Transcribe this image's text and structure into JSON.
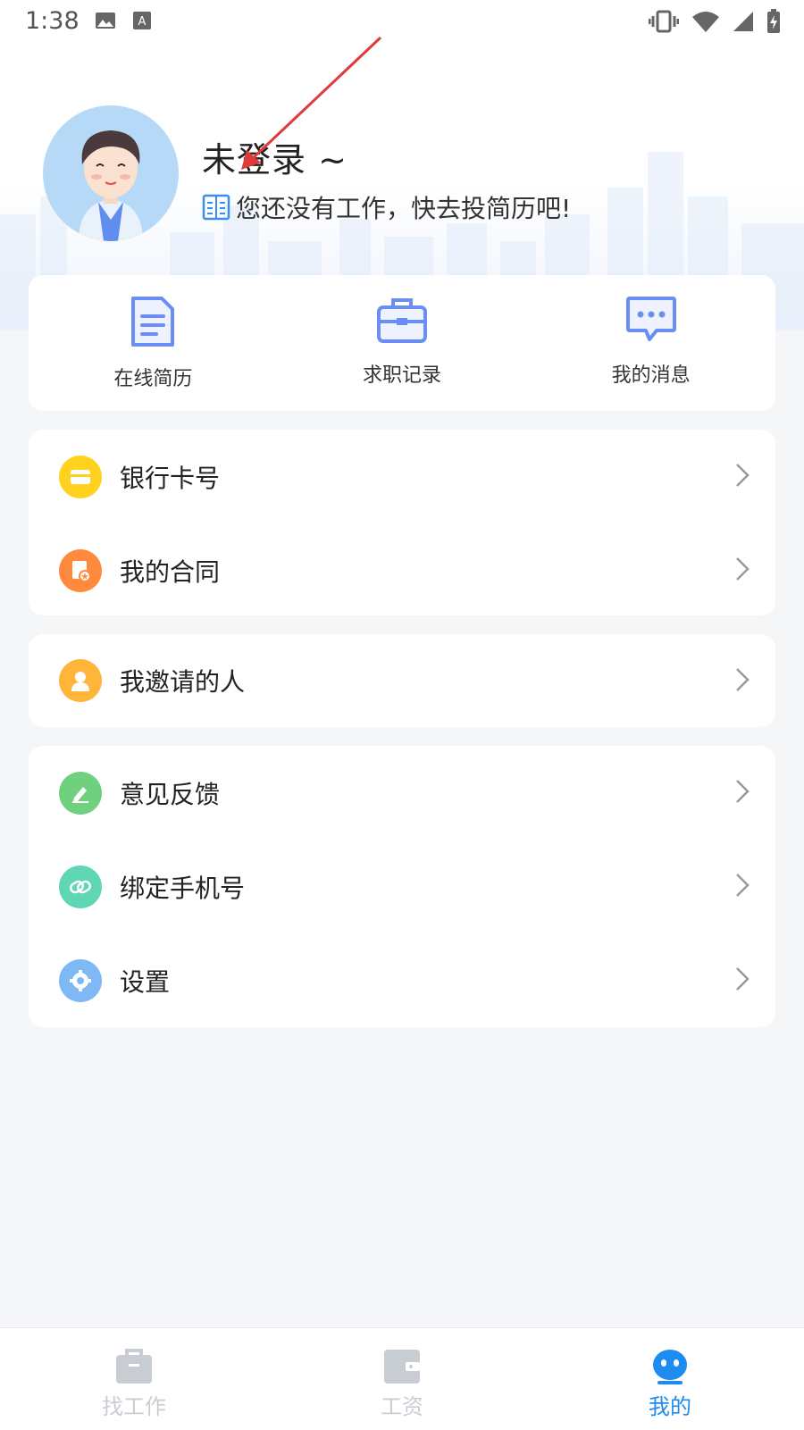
{
  "status_bar": {
    "time": "1:38",
    "left_icons": [
      "image-icon",
      "font-icon"
    ],
    "right_icons": [
      "vibrate-icon",
      "wifi-icon",
      "signal-icon",
      "battery-charging-icon"
    ]
  },
  "profile": {
    "name": "未登录 ~",
    "hint": "您还没有工作，快去投简历吧!"
  },
  "quick_actions": [
    {
      "label": "在线简历",
      "icon": "resume-icon"
    },
    {
      "label": "求职记录",
      "icon": "briefcase-icon"
    },
    {
      "label": "我的消息",
      "icon": "message-icon"
    }
  ],
  "menu_groups": [
    [
      {
        "label": "银行卡号",
        "icon": "bank-card-icon",
        "color": "#FFD21F"
      },
      {
        "label": "我的合同",
        "icon": "contract-icon",
        "color": "#FF8A3D"
      }
    ],
    [
      {
        "label": "我邀请的人",
        "icon": "person-icon",
        "color": "#FFB43A"
      }
    ],
    [
      {
        "label": "意见反馈",
        "icon": "edit-icon",
        "color": "#6FD07E"
      },
      {
        "label": "绑定手机号",
        "icon": "link-icon",
        "color": "#5FD7B5"
      },
      {
        "label": "设置",
        "icon": "gear-icon",
        "color": "#7FB9F5"
      }
    ]
  ],
  "bottom_nav": [
    {
      "label": "找工作",
      "icon": "briefcase-icon",
      "active": false
    },
    {
      "label": "工资",
      "icon": "wallet-icon",
      "active": false
    },
    {
      "label": "我的",
      "icon": "face-icon",
      "active": true
    }
  ],
  "colors": {
    "accent": "#1E8BF0",
    "nav_inactive": "#C8CDD4",
    "quick_icon": "#6B8EF5"
  }
}
